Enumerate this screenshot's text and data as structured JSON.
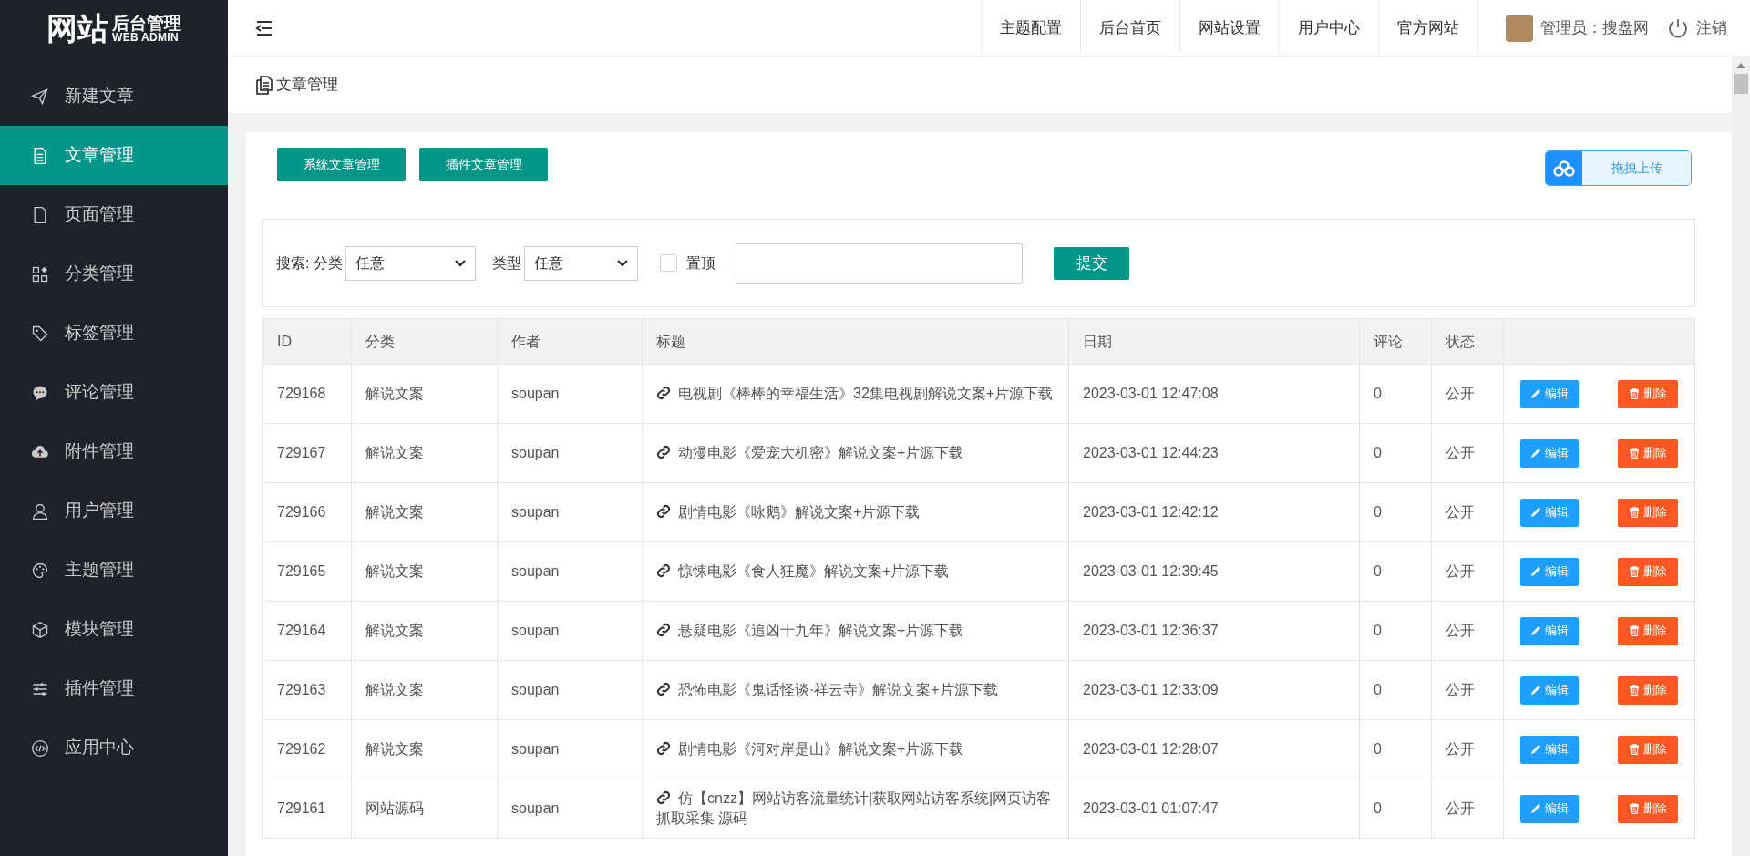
{
  "logo": {
    "main": "网站",
    "sub": "后台管理",
    "en": "WEB ADMIN"
  },
  "sidebar": {
    "items": [
      {
        "label": "新建文章",
        "selected": false
      },
      {
        "label": "文章管理",
        "selected": true
      },
      {
        "label": "页面管理",
        "selected": false
      },
      {
        "label": "分类管理",
        "selected": false
      },
      {
        "label": "标签管理",
        "selected": false
      },
      {
        "label": "评论管理",
        "selected": false
      },
      {
        "label": "附件管理",
        "selected": false
      },
      {
        "label": "用户管理",
        "selected": false
      },
      {
        "label": "主题管理",
        "selected": false
      },
      {
        "label": "模块管理",
        "selected": false
      },
      {
        "label": "插件管理",
        "selected": false
      },
      {
        "label": "应用中心",
        "selected": false
      }
    ]
  },
  "header": {
    "nav": [
      "主题配置",
      "后台首页",
      "网站设置",
      "用户中心",
      "官方网站"
    ],
    "user": "管理员：搜盘网",
    "logout": "注销"
  },
  "breadcrumb": "文章管理",
  "toolbar": {
    "buttons": [
      "系统文章管理",
      "插件文章管理"
    ],
    "upload": "拖拽上传"
  },
  "search": {
    "label": "搜索:",
    "category_label": "分类",
    "category_value": "任意",
    "type_label": "类型",
    "type_value": "任意",
    "pinned_label": "置顶",
    "pinned": false,
    "submit": "提交"
  },
  "table": {
    "columns": [
      "ID",
      "分类",
      "作者",
      "标题",
      "日期",
      "评论",
      "状态"
    ],
    "rows": [
      {
        "id": "729168",
        "category": "解说文案",
        "author": "soupan",
        "title": "电视剧《棒棒的幸福生活》32集电视剧解说文案+片源下载",
        "date": "2023-03-01 12:47:08",
        "comments": "0",
        "status": "公开",
        "edit": "编辑",
        "delete": "删除"
      },
      {
        "id": "729167",
        "category": "解说文案",
        "author": "soupan",
        "title": "动漫电影《爱宠大机密》解说文案+片源下载",
        "date": "2023-03-01 12:44:23",
        "comments": "0",
        "status": "公开",
        "edit": "编辑",
        "delete": "删除"
      },
      {
        "id": "729166",
        "category": "解说文案",
        "author": "soupan",
        "title": "剧情电影《咏鹅》解说文案+片源下载",
        "date": "2023-03-01 12:42:12",
        "comments": "0",
        "status": "公开",
        "edit": "编辑",
        "delete": "删除"
      },
      {
        "id": "729165",
        "category": "解说文案",
        "author": "soupan",
        "title": "惊悚电影《食人狂魔》解说文案+片源下载",
        "date": "2023-03-01 12:39:45",
        "comments": "0",
        "status": "公开",
        "edit": "编辑",
        "delete": "删除"
      },
      {
        "id": "729164",
        "category": "解说文案",
        "author": "soupan",
        "title": "悬疑电影《追凶十九年》解说文案+片源下载",
        "date": "2023-03-01 12:36:37",
        "comments": "0",
        "status": "公开",
        "edit": "编辑",
        "delete": "删除"
      },
      {
        "id": "729163",
        "category": "解说文案",
        "author": "soupan",
        "title": "恐怖电影《鬼话怪谈·祥云寺》解说文案+片源下载",
        "date": "2023-03-01 12:33:09",
        "comments": "0",
        "status": "公开",
        "edit": "编辑",
        "delete": "删除"
      },
      {
        "id": "729162",
        "category": "解说文案",
        "author": "soupan",
        "title": "剧情电影《河对岸是山》解说文案+片源下载",
        "date": "2023-03-01 12:28:07",
        "comments": "0",
        "status": "公开",
        "edit": "编辑",
        "delete": "删除"
      },
      {
        "id": "729161",
        "category": "网站源码",
        "author": "soupan",
        "title": "仿【cnzz】网站访客流量统计|获取网站访客系统|网页访客抓取采集 源码",
        "date": "2023-03-01 01:07:47",
        "comments": "0",
        "status": "公开",
        "edit": "编辑",
        "delete": "删除"
      }
    ]
  }
}
